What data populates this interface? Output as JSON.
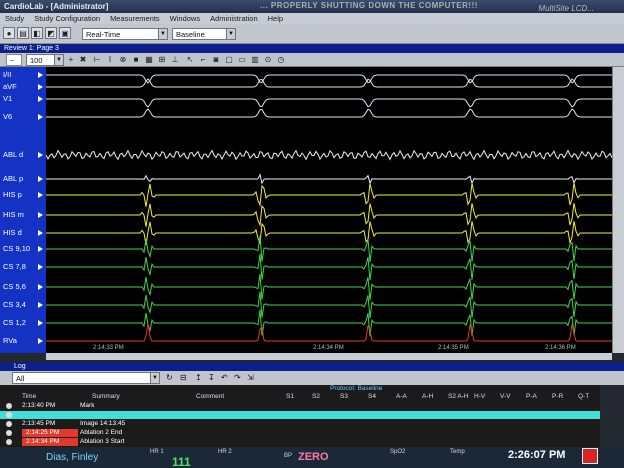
{
  "titlebar": {
    "title": "CardioLab - [Administrator]",
    "banner": "... PROPERLY SHUTTING DOWN THE COMPUTER!!!",
    "brand": "MultiSite LCD..."
  },
  "menu": [
    "Study",
    "Study Configuration",
    "Measurements",
    "Windows",
    "Administration",
    "Help"
  ],
  "toolbar": {
    "mode": "Real-Time",
    "baseline": "Baseline"
  },
  "review": {
    "tab_label": "Review 1: Page 3",
    "speed": "100"
  },
  "channels": [
    {
      "label": "I/II",
      "color": "#d8e6f2"
    },
    {
      "label": "aVF",
      "color": "#d8e6f2"
    },
    {
      "label": "V1",
      "color": "#d8e6f2"
    },
    {
      "label": "V6",
      "color": "#d8e6f2"
    },
    {
      "label": "ABL d",
      "color": "#eeeeee"
    },
    {
      "label": "ABL p",
      "color": "#eeeeee"
    },
    {
      "label": "HIS p",
      "color": "#f2ee40"
    },
    {
      "label": "HIS m",
      "color": "#f2ee40"
    },
    {
      "label": "HIS d",
      "color": "#f2ee40"
    },
    {
      "label": "CS 9,10",
      "color": "#3fd64a"
    },
    {
      "label": "CS 7,8",
      "color": "#3fd64a"
    },
    {
      "label": "CS 5,6",
      "color": "#3fd64a"
    },
    {
      "label": "CS 3,4",
      "color": "#3fd64a"
    },
    {
      "label": "CS 1,2",
      "color": "#3fd64a"
    },
    {
      "label": "RVa",
      "color": "#e33a2a"
    }
  ],
  "beats": [
    0.18,
    0.38,
    0.57,
    0.75,
    0.93
  ],
  "time_marks": [
    "2:14:33 PM",
    "2:14:34 PM",
    "2:14:35 PM",
    "2:14:36 PM"
  ],
  "log": {
    "tab_label": "Log",
    "filter": "All",
    "headers": [
      "Time",
      "Summary",
      "Comment",
      "S1",
      "S2",
      "S3",
      "S4",
      "A-A",
      "A-H",
      "S2 A-H",
      "H-V",
      "V-V",
      "P-A",
      "P-R",
      "Q-T"
    ],
    "protocol": "Protocol: Baseline",
    "rows": [
      {
        "time": "2:13:40 PM",
        "summary": "Mark",
        "comment": "",
        "highlight": "none"
      },
      {
        "time": "",
        "summary": "",
        "comment": "",
        "highlight": "cyan"
      },
      {
        "time": "2:13:45 PM",
        "summary": "Image 14:13:45",
        "comment": "",
        "highlight": "none"
      },
      {
        "time": "2:14:25 PM",
        "summary": "Ablation 2 End",
        "comment": "",
        "highlight": "red"
      },
      {
        "time": "2:14:34 PM",
        "summary": "Ablation 3 Start",
        "comment": "",
        "highlight": "red"
      }
    ]
  },
  "status": {
    "patient": "Dias, Finley",
    "hr1_label": "HR 1",
    "hr1": "111",
    "hr2_label": "HR 2",
    "bp_label": "BP",
    "bp_value": "ZERO",
    "spo2_label": "SpO2",
    "temp_label": "Temp",
    "clock": "2:26:07 PM"
  },
  "colors": {
    "label_panel": "#1432c4",
    "tab_bar": "#0e1f8a",
    "log_cyan": "#3fe0d8",
    "log_red": "#e03a2a"
  }
}
